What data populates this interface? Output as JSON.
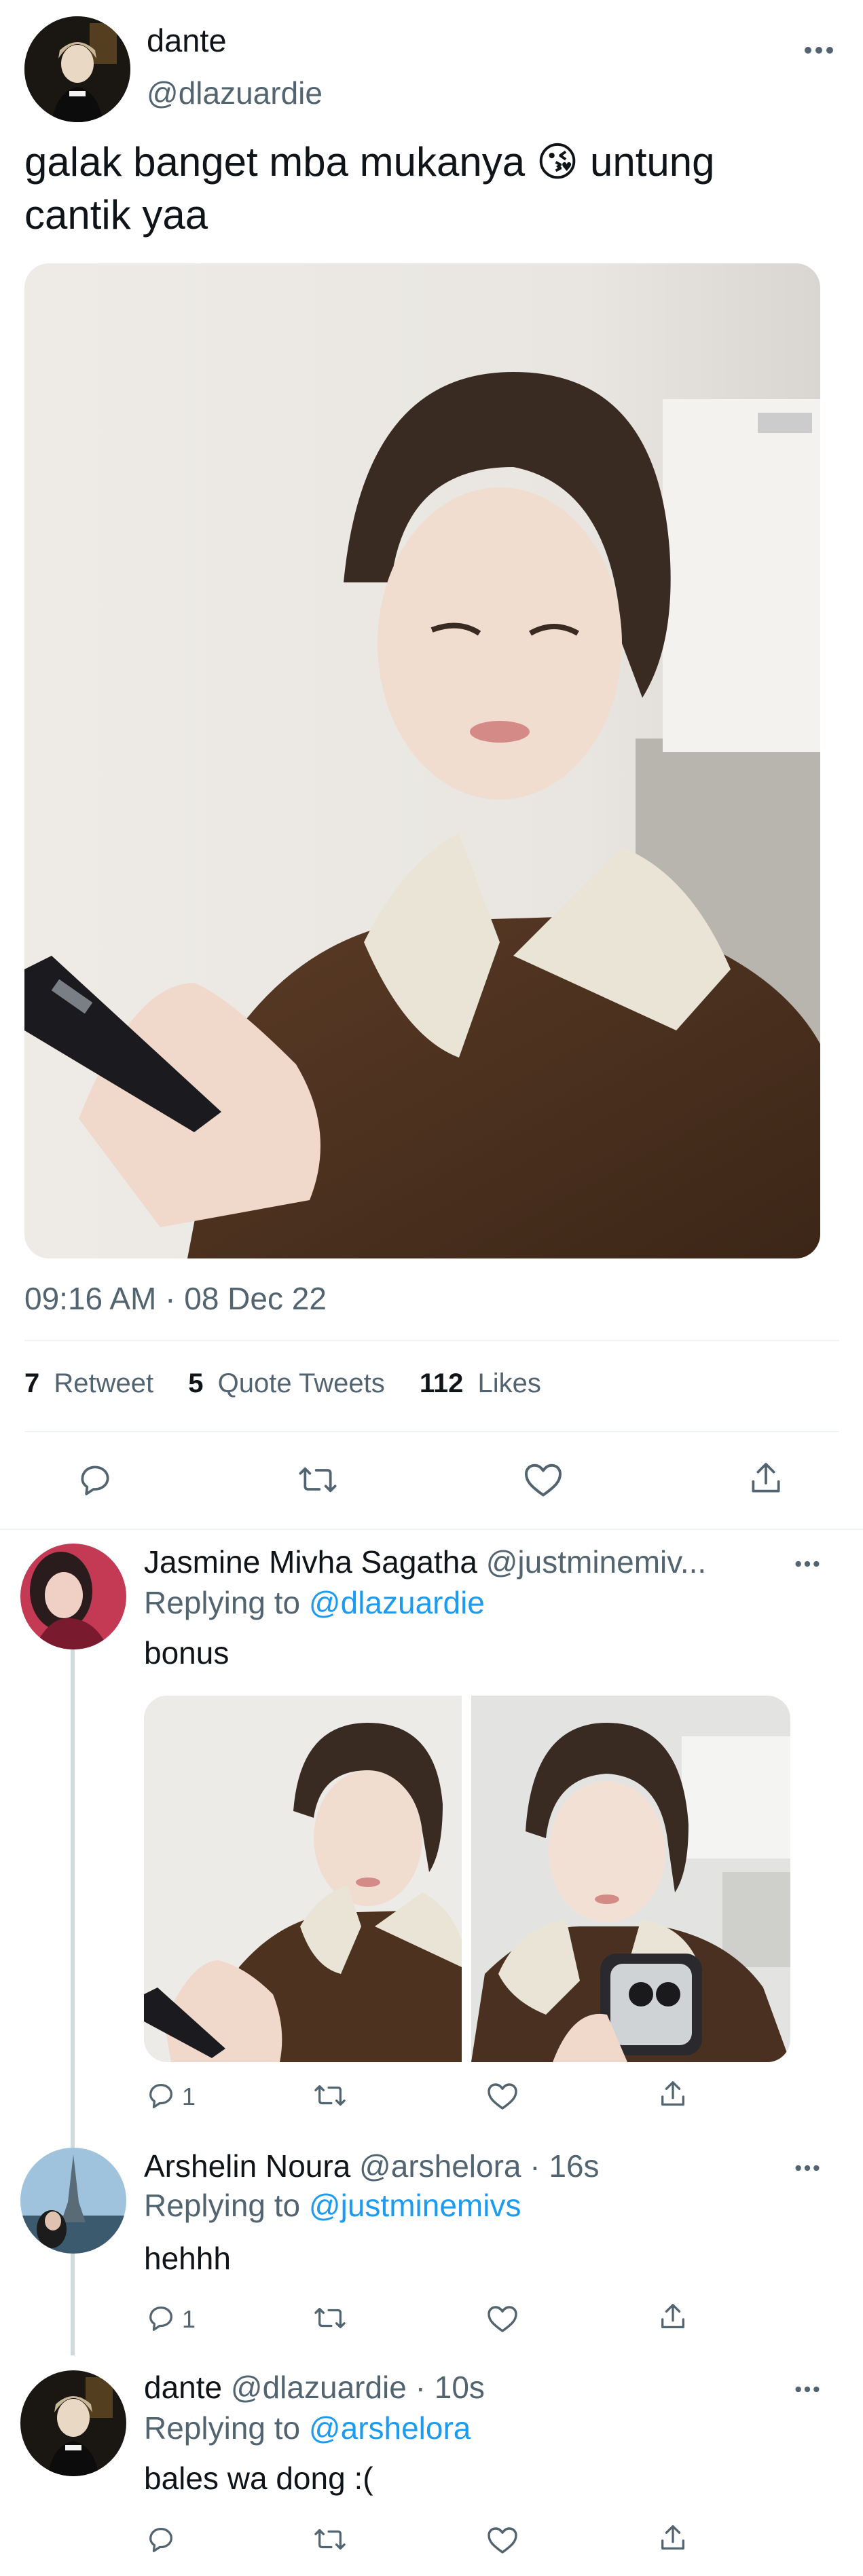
{
  "main_tweet": {
    "author_name": "dante",
    "author_handle": "@dlazuardie",
    "text": "galak banget mba mukanya 😘 untung cantik yaa",
    "timestamp": "09:16 AM · 08 Dec 22",
    "stats": {
      "retweet_count": "7",
      "retweet_label": "Retweet",
      "quote_count": "5",
      "quote_label": "Quote Tweets",
      "like_count": "112",
      "like_label": "Likes"
    },
    "more_icon": "more-horizontal-icon",
    "actions": [
      "reply-icon",
      "retweet-icon",
      "like-icon",
      "share-icon"
    ]
  },
  "replies": [
    {
      "author_name": "Jasmine Mivha Sagatha",
      "author_handle": "@justminemiv...",
      "replying_prefix": "Replying to",
      "replying_to": "@dlazuardie",
      "text": "bonus",
      "reply_count": "1"
    },
    {
      "author_name": "Arshelin Noura",
      "author_handle": "@arshelora · 16s",
      "replying_prefix": "Replying to",
      "replying_to": "@justminemivs",
      "text": "hehhh",
      "reply_count": "1"
    },
    {
      "author_name": "dante",
      "author_handle": "@dlazuardie · 10s",
      "replying_prefix": "Replying to",
      "replying_to": "@arshelora",
      "text": "bales wa dong :(",
      "reply_count": ""
    }
  ],
  "colors": {
    "accent": "#1d9bf0",
    "secondary_text": "#536471",
    "divider": "#eff3f4"
  }
}
